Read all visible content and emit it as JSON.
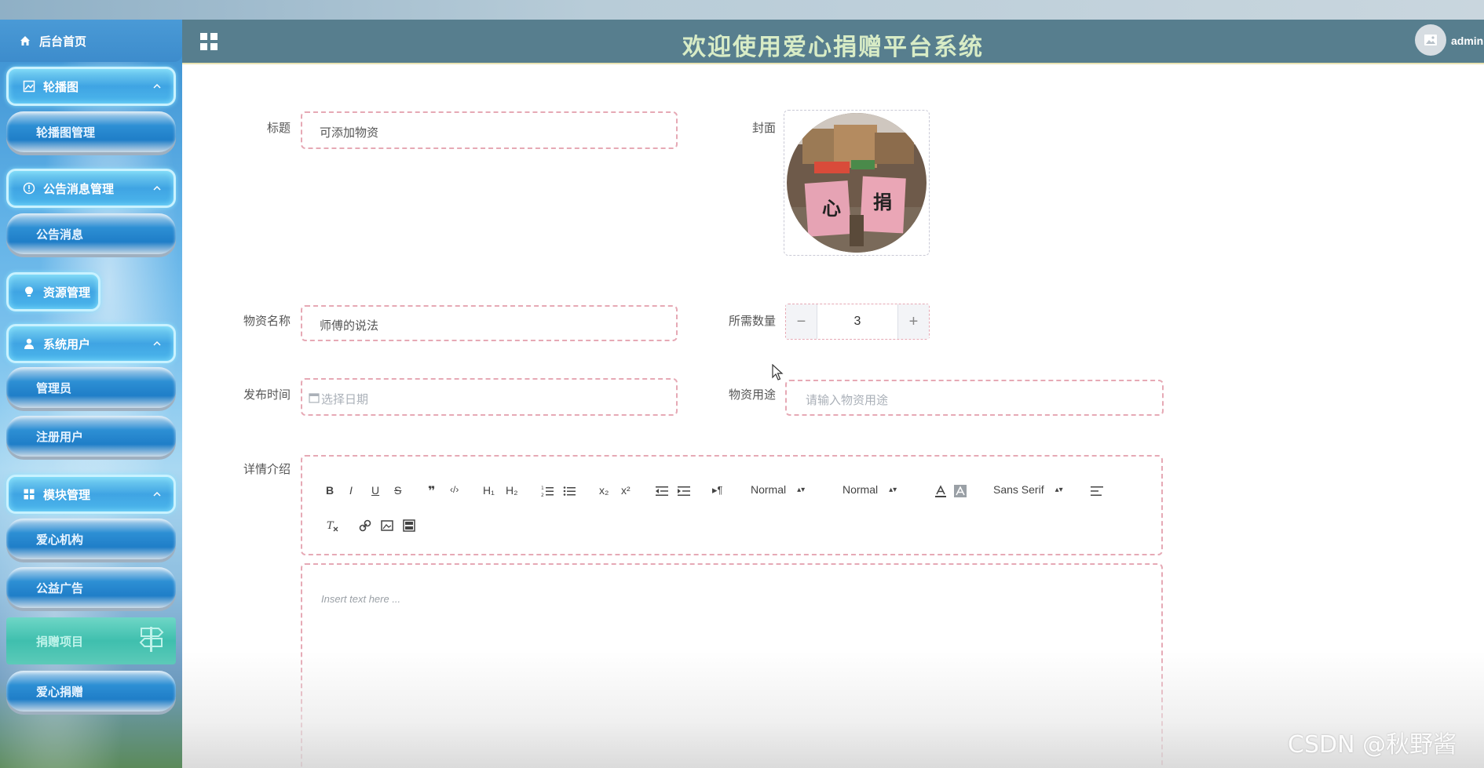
{
  "header": {
    "title": "欢迎使用爱心捐赠平台系统",
    "username": "admin"
  },
  "sidebar": {
    "home": "后台首页",
    "groups": [
      {
        "label": "轮播图",
        "items": [
          "轮播图管理"
        ]
      },
      {
        "label": "公告消息管理",
        "items": [
          "公告消息"
        ]
      },
      {
        "label": "资源管理",
        "items": []
      },
      {
        "label": "系统用户",
        "items": [
          "管理员",
          "注册用户"
        ]
      },
      {
        "label": "模块管理",
        "items": [
          "爱心机构",
          "公益广告",
          "捐赠项目",
          "爱心捐赠"
        ]
      }
    ]
  },
  "form": {
    "title_label": "标题",
    "title_value": "可添加物资",
    "cover_label": "封面",
    "cover_text": [
      "心",
      "捐"
    ],
    "name_label": "物资名称",
    "name_value": "师傅的说法",
    "qty_label": "所需数量",
    "qty_value": "3",
    "qty_minus": "−",
    "qty_plus": "+",
    "date_label": "发布时间",
    "date_placeholder": "选择日期",
    "usage_label": "物资用途",
    "usage_placeholder": "请输入物资用途",
    "detail_label": "详情介绍",
    "editor_placeholder": "Insert text here ..."
  },
  "toolbar": {
    "bold": "B",
    "italic": "I",
    "underline": "U",
    "strike": "S",
    "quote": "❞",
    "code": "‹/›",
    "h1": "H₁",
    "h2": "H₂",
    "sub": "x₂",
    "sup": "x²",
    "direction": "▸¶",
    "size": "Normal",
    "header": "Normal",
    "font": "Sans Serif"
  },
  "watermark": "CSDN @秋野酱",
  "colors": {
    "header_bg": "#577e8e",
    "title_color": "#d8ecc6",
    "border_dashed": "#e6a9b5"
  }
}
